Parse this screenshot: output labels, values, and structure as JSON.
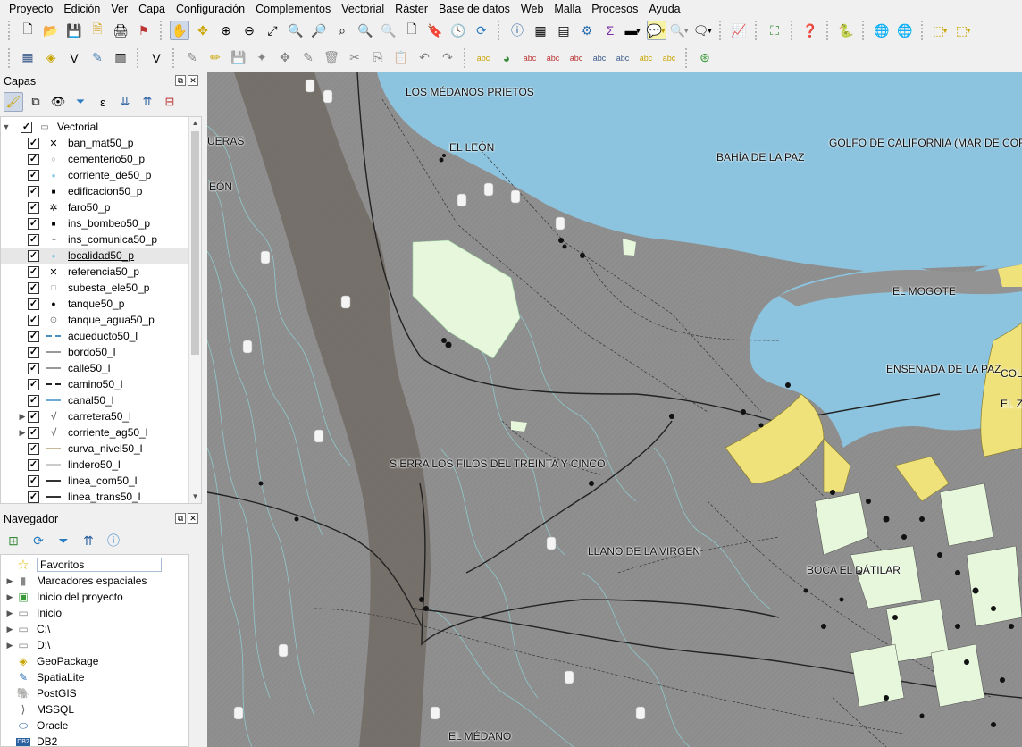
{
  "menu": [
    "Proyecto",
    "Edición",
    "Ver",
    "Capa",
    "Configuración",
    "Complementos",
    "Vectorial",
    "Ráster",
    "Base de datos",
    "Web",
    "Malla",
    "Procesos",
    "Ayuda"
  ],
  "layers_panel": {
    "title": "Capas",
    "group": "Vectorial",
    "layers": [
      {
        "name": "ban_mat50_p",
        "symbol": "cross-symbol",
        "checked": true
      },
      {
        "name": "cementerio50_p",
        "symbol": "circle-symbol",
        "checked": true
      },
      {
        "name": "corriente_de50_p",
        "symbol": "dot-blue-symbol",
        "checked": true
      },
      {
        "name": "edificacion50_p",
        "symbol": "square-black-symbol",
        "checked": true
      },
      {
        "name": "faro50_p",
        "symbol": "star-symbol",
        "checked": true
      },
      {
        "name": "ins_bombeo50_p",
        "symbol": "square-black-symbol",
        "checked": true
      },
      {
        "name": "ins_comunica50_p",
        "symbol": "antenna-symbol",
        "checked": true
      },
      {
        "name": "localidad50_p",
        "symbol": "dot-blue-symbol",
        "checked": true,
        "selected": true
      },
      {
        "name": "referencia50_p",
        "symbol": "cross-symbol",
        "checked": true
      },
      {
        "name": "subesta_ele50_p",
        "symbol": "square-outline-symbol",
        "checked": true
      },
      {
        "name": "tanque50_p",
        "symbol": "dot-black-symbol",
        "checked": true
      },
      {
        "name": "tanque_agua50_p",
        "symbol": "circle-dot-symbol",
        "checked": true
      },
      {
        "name": "acueducto50_l",
        "symbol": "line-dashed-blue-symbol",
        "checked": true
      },
      {
        "name": "bordo50_l",
        "symbol": "line-gray-symbol",
        "checked": true
      },
      {
        "name": "calle50_l",
        "symbol": "line-gray-symbol",
        "checked": true
      },
      {
        "name": "camino50_l",
        "symbol": "line-dashed-black-symbol",
        "checked": true
      },
      {
        "name": "canal50_l",
        "symbol": "line-blue-symbol",
        "checked": true
      },
      {
        "name": "carretera50_l",
        "symbol": "rule-symbol",
        "checked": true,
        "expandable": true
      },
      {
        "name": "corriente_ag50_l",
        "symbol": "rule-symbol",
        "checked": true,
        "expandable": true
      },
      {
        "name": "curva_nivel50_l",
        "symbol": "line-tan-symbol",
        "checked": true
      },
      {
        "name": "lindero50_l",
        "symbol": "line-light-symbol",
        "checked": true
      },
      {
        "name": "linea_com50_l",
        "symbol": "line-tick-symbol",
        "checked": true
      },
      {
        "name": "linea_trans50_l",
        "symbol": "line-tick-symbol",
        "checked": true
      }
    ]
  },
  "navigator_panel": {
    "title": "Navegador",
    "items": [
      {
        "label": "Favoritos",
        "icon": "star-icon",
        "expandable": false,
        "boxed": true
      },
      {
        "label": "Marcadores espaciales",
        "icon": "bookmark-icon",
        "expandable": true
      },
      {
        "label": "Inicio del proyecto",
        "icon": "project-home-icon",
        "expandable": true
      },
      {
        "label": "Inicio",
        "icon": "folder-icon",
        "expandable": true
      },
      {
        "label": "C:\\",
        "icon": "folder-icon",
        "expandable": true
      },
      {
        "label": "D:\\",
        "icon": "folder-icon",
        "expandable": true
      },
      {
        "label": "GeoPackage",
        "icon": "geopackage-icon",
        "expandable": false
      },
      {
        "label": "SpatiaLite",
        "icon": "spatialite-icon",
        "expandable": false
      },
      {
        "label": "PostGIS",
        "icon": "postgis-icon",
        "expandable": false
      },
      {
        "label": "MSSQL",
        "icon": "mssql-icon",
        "expandable": false
      },
      {
        "label": "Oracle",
        "icon": "oracle-icon",
        "expandable": false
      },
      {
        "label": "DB2",
        "icon": "db2-icon",
        "expandable": false
      }
    ]
  },
  "map": {
    "labels": {
      "medanos": "LOS MÉDANOS PRIETOS",
      "leon": "EL LEÓN",
      "bahia": "BAHÍA DE LA PAZ",
      "golfo": "GOLFO DE CALIFORNIA (MAR DE CORTÉS)",
      "mogote": "EL MOGOTE",
      "ensenada": "ENSENADA DE LA PAZ",
      "sierra": "SIERRA LOS FILOS DEL TREINTA Y CINCO",
      "llano": "LLANO DE LA VIRGEN",
      "boca": "BOCA EL DÁTILAR",
      "medano": "EL MÉDANO",
      "queras": "UERAS",
      "leon2": "EÓN",
      "col": "COL",
      "elza": "EL ZA"
    },
    "colors": {
      "water": "#8cc4df",
      "land": "#8f8f8f",
      "urban": "#efe27a",
      "fields": "#e6f7dc",
      "contour": "#8fd3d6"
    }
  }
}
